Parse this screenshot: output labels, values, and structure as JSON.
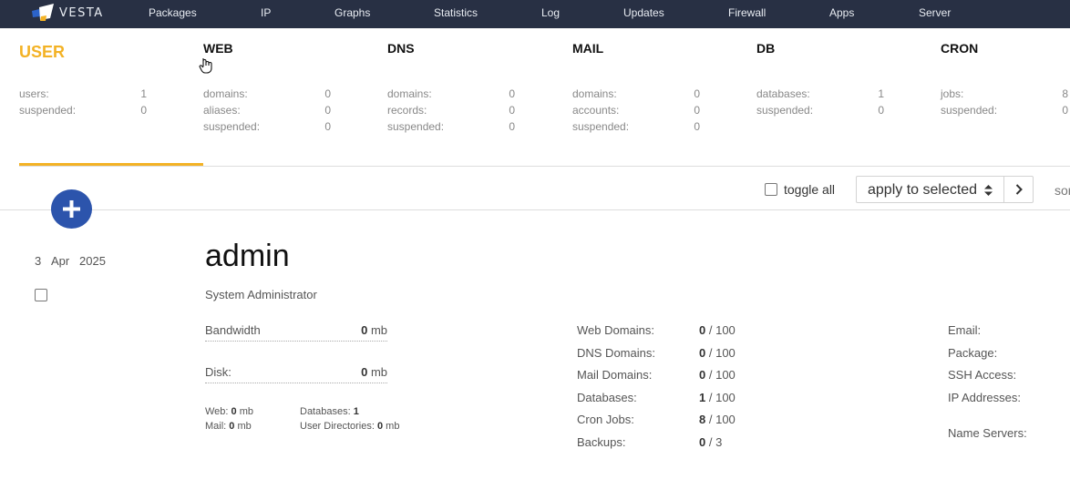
{
  "brand": {
    "name": "VESTA"
  },
  "nav": [
    {
      "label": "Packages"
    },
    {
      "label": "IP"
    },
    {
      "label": "Graphs"
    },
    {
      "label": "Statistics"
    },
    {
      "label": "Log"
    },
    {
      "label": "Updates"
    },
    {
      "label": "Firewall"
    },
    {
      "label": "Apps"
    },
    {
      "label": "Server"
    }
  ],
  "stats": {
    "user": {
      "title": "USER",
      "rows": [
        {
          "label": "users:",
          "value": "1"
        },
        {
          "label": "suspended:",
          "value": "0"
        }
      ]
    },
    "web": {
      "title": "WEB",
      "rows": [
        {
          "label": "domains:",
          "value": "0"
        },
        {
          "label": "aliases:",
          "value": "0"
        },
        {
          "label": "suspended:",
          "value": "0"
        }
      ]
    },
    "dns": {
      "title": "DNS",
      "rows": [
        {
          "label": "domains:",
          "value": "0"
        },
        {
          "label": "records:",
          "value": "0"
        },
        {
          "label": "suspended:",
          "value": "0"
        }
      ]
    },
    "mail": {
      "title": "MAIL",
      "rows": [
        {
          "label": "domains:",
          "value": "0"
        },
        {
          "label": "accounts:",
          "value": "0"
        },
        {
          "label": "suspended:",
          "value": "0"
        }
      ]
    },
    "db": {
      "title": "DB",
      "rows": [
        {
          "label": "databases:",
          "value": "1"
        },
        {
          "label": "suspended:",
          "value": "0"
        }
      ]
    },
    "cron": {
      "title": "CRON",
      "rows": [
        {
          "label": "jobs:",
          "value": "8"
        },
        {
          "label": "suspended:",
          "value": "0"
        }
      ]
    }
  },
  "toolbar": {
    "toggle_all": "toggle all",
    "apply_selected": "apply to selected",
    "sort": "sort"
  },
  "user": {
    "date": {
      "day": "3",
      "month": "Apr",
      "year": "2025"
    },
    "name": "admin",
    "role": "System Administrator",
    "bandwidth": {
      "label": "Bandwidth",
      "value": "0",
      "unit": "mb"
    },
    "disk": {
      "label": "Disk:",
      "value": "0",
      "unit": "mb"
    },
    "usage": {
      "web": {
        "label": "Web:",
        "value": "0",
        "unit": "mb"
      },
      "mail": {
        "label": "Mail:",
        "value": "0",
        "unit": "mb"
      },
      "databases": {
        "label": "Databases:",
        "value": "1"
      },
      "user_dirs": {
        "label": "User Directories:",
        "value": "0",
        "unit": "mb"
      }
    },
    "limits": [
      {
        "label": "Web Domains:",
        "used": "0",
        "max": "/ 100"
      },
      {
        "label": "DNS Domains:",
        "used": "0",
        "max": "/ 100"
      },
      {
        "label": "Mail Domains:",
        "used": "0",
        "max": "/ 100"
      },
      {
        "label": "Databases:",
        "used": "1",
        "max": "/ 100"
      },
      {
        "label": "Cron Jobs:",
        "used": "8",
        "max": "/ 100"
      },
      {
        "label": "Backups:",
        "used": "0",
        "max": "/ 3"
      }
    ],
    "info": [
      {
        "label": "Email:"
      },
      {
        "label": "Package:"
      },
      {
        "label": "SSH Access:"
      },
      {
        "label": "IP Addresses:"
      },
      {
        "label": "Name Servers:"
      }
    ]
  },
  "colors": {
    "nav_bg": "#283044",
    "accent": "#f3b225",
    "add_button": "#2c54ac"
  }
}
